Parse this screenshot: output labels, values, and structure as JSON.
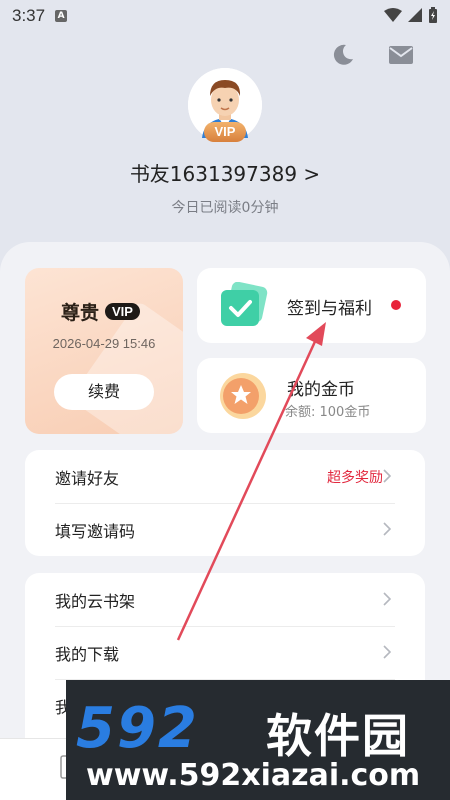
{
  "status_bar": {
    "time": "3:37",
    "indicator": "A"
  },
  "header": {
    "icons": [
      "moon-icon",
      "mail-icon"
    ],
    "avatar_badge": "VIP",
    "username": "书友1631397389 >",
    "reading_today": "今日已阅读0分钟"
  },
  "vip_card": {
    "title": "尊贵",
    "badge": "VIP",
    "expire": "2026-04-29 15:46",
    "renew_label": "续费"
  },
  "sign_card": {
    "label": "签到与福利",
    "has_dot": true
  },
  "coin_card": {
    "label": "我的金币",
    "balance": "余额: 100金币"
  },
  "list_1": [
    {
      "label": "邀请好友",
      "extra": "超多奖励"
    },
    {
      "label": "填写邀请码",
      "extra": ""
    }
  ],
  "list_2": [
    {
      "label": "我的云书架"
    },
    {
      "label": "我的下载"
    },
    {
      "label": "我"
    }
  ],
  "watermark": {
    "logo": "592",
    "cn": "软件园",
    "url": "www.592xiazai.com"
  },
  "colors": {
    "accent_red": "#e8233a",
    "vip_gradient": "#f8cdb3",
    "watermark_blue": "#2a7de1"
  }
}
